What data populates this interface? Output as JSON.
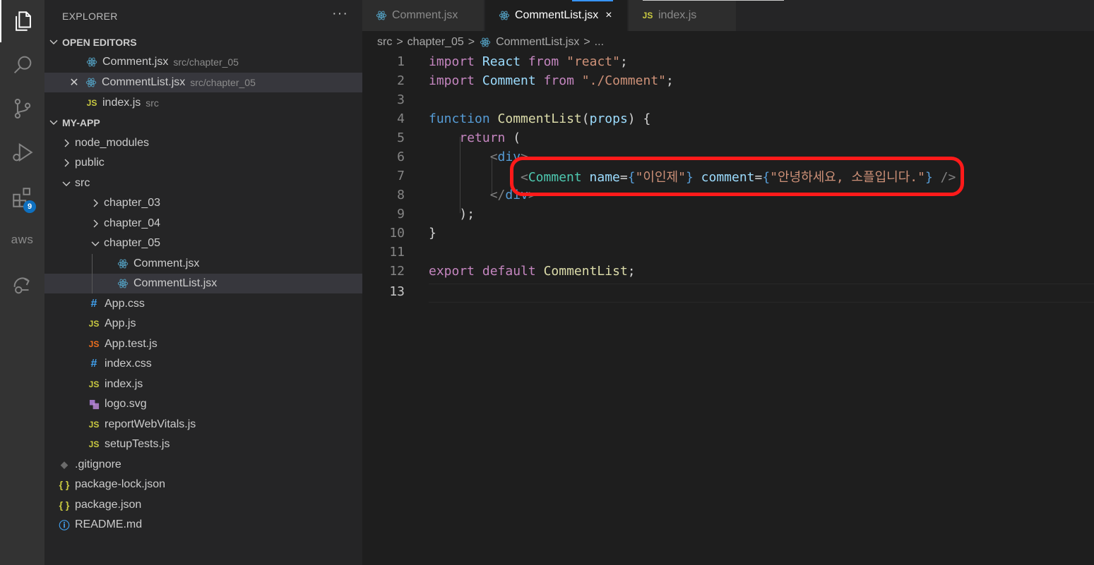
{
  "activity_bar": {
    "items": [
      {
        "icon": "files-icon"
      },
      {
        "icon": "search-icon"
      },
      {
        "icon": "source-control-icon"
      },
      {
        "icon": "run-debug-icon"
      },
      {
        "icon": "extensions-icon",
        "badge": "9"
      },
      {
        "icon": "aws-icon",
        "label": "aws"
      },
      {
        "icon": "remote-explorer-icon"
      }
    ]
  },
  "sidebar": {
    "title": "EXPLORER",
    "more": "···",
    "open_editors": {
      "label": "OPEN EDITORS",
      "items": [
        {
          "name": "Comment.jsx",
          "path": "src/chapter_05"
        },
        {
          "name": "CommentList.jsx",
          "path": "src/chapter_05"
        },
        {
          "name": "index.js",
          "path": "src"
        }
      ]
    },
    "project": {
      "label": "MY-APP",
      "tree": [
        "node_modules",
        "public",
        "src",
        "chapter_03",
        "chapter_04",
        "chapter_05",
        "Comment.jsx",
        "CommentList.jsx",
        "App.css",
        "App.js",
        "App.test.js",
        "index.css",
        "index.js",
        "logo.svg",
        "reportWebVitals.js",
        "setupTests.js",
        ".gitignore",
        "package-lock.json",
        "package.json",
        "README.md"
      ]
    }
  },
  "tabs": [
    {
      "label": "Comment.jsx"
    },
    {
      "label": "CommentList.jsx",
      "close": "×"
    },
    {
      "label": "index.js"
    }
  ],
  "icon_glyphs": {
    "js": "JS",
    "css": "#",
    "json": "{ }",
    "info": "ⓘ"
  },
  "breadcrumb": {
    "parts": [
      "src",
      "chapter_05",
      "CommentList.jsx",
      "..."
    ],
    "separator": ">"
  },
  "editor": {
    "line_numbers": [
      "1",
      "2",
      "3",
      "4",
      "5",
      "6",
      "7",
      "8",
      "9",
      "10",
      "11",
      "12",
      "13"
    ],
    "lines": {
      "l1": {
        "kw": "import",
        "id": "React",
        "from": "from",
        "str": "\"react\"",
        "end": ";"
      },
      "l2": {
        "kw": "import",
        "id": "Comment",
        "from": "from",
        "str": "\"./Comment\"",
        "end": ";"
      },
      "l4": {
        "kw": "function",
        "fn": "CommentList",
        "open": "(",
        "param": "props",
        "close": ") {"
      },
      "l5": {
        "kw": "return",
        "rest": " ("
      },
      "l6": {
        "tag_open": "<",
        "tag": "div",
        "tag_close": ">"
      },
      "l7": {
        "lt": "<",
        "tag": "Comment",
        "attr1": "name",
        "eq1": "=",
        "b1o": "{",
        "v1": "\"이인제\"",
        "b1c": "}",
        "attr2": "comment",
        "eq2": "=",
        "b2o": "{",
        "v2": "\"안녕하세요, 소플입니다.\"",
        "b2c": "}",
        "selfclose": "/>"
      },
      "l8": {
        "tag_open": "</",
        "tag": "div",
        "tag_close": ">"
      },
      "l9": {
        "text": ");"
      },
      "l10": {
        "text": "}"
      },
      "l12": {
        "kw": "export",
        "kw2": "default",
        "fn": "CommentList",
        "end": ";"
      }
    }
  },
  "colors": {
    "annotation": "#ff1a1a",
    "accent": "#3794ff"
  }
}
